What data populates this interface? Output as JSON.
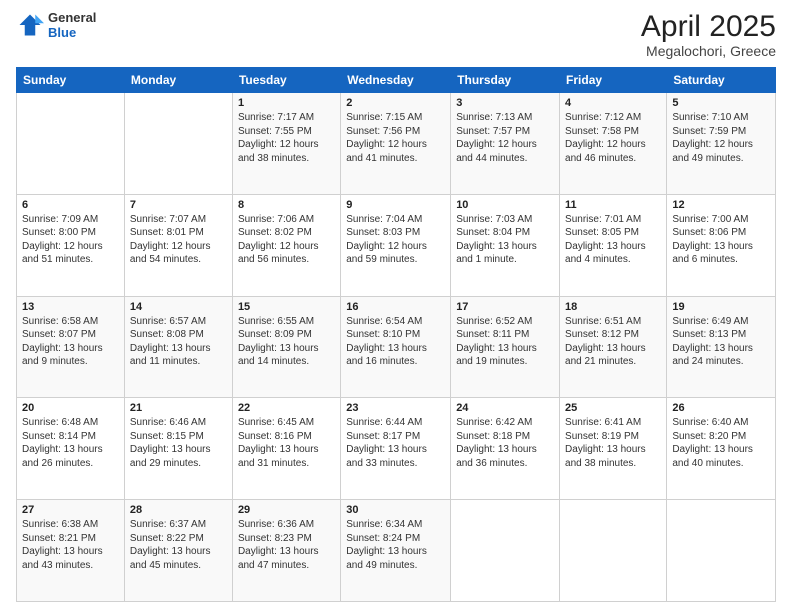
{
  "header": {
    "logo": {
      "general": "General",
      "blue": "Blue"
    },
    "title": "April 2025",
    "location": "Megalochori, Greece"
  },
  "weekdays": [
    "Sunday",
    "Monday",
    "Tuesday",
    "Wednesday",
    "Thursday",
    "Friday",
    "Saturday"
  ],
  "weeks": [
    [
      {
        "day": "",
        "info": ""
      },
      {
        "day": "",
        "info": ""
      },
      {
        "day": "1",
        "info": "Sunrise: 7:17 AM\nSunset: 7:55 PM\nDaylight: 12 hours and 38 minutes."
      },
      {
        "day": "2",
        "info": "Sunrise: 7:15 AM\nSunset: 7:56 PM\nDaylight: 12 hours and 41 minutes."
      },
      {
        "day": "3",
        "info": "Sunrise: 7:13 AM\nSunset: 7:57 PM\nDaylight: 12 hours and 44 minutes."
      },
      {
        "day": "4",
        "info": "Sunrise: 7:12 AM\nSunset: 7:58 PM\nDaylight: 12 hours and 46 minutes."
      },
      {
        "day": "5",
        "info": "Sunrise: 7:10 AM\nSunset: 7:59 PM\nDaylight: 12 hours and 49 minutes."
      }
    ],
    [
      {
        "day": "6",
        "info": "Sunrise: 7:09 AM\nSunset: 8:00 PM\nDaylight: 12 hours and 51 minutes."
      },
      {
        "day": "7",
        "info": "Sunrise: 7:07 AM\nSunset: 8:01 PM\nDaylight: 12 hours and 54 minutes."
      },
      {
        "day": "8",
        "info": "Sunrise: 7:06 AM\nSunset: 8:02 PM\nDaylight: 12 hours and 56 minutes."
      },
      {
        "day": "9",
        "info": "Sunrise: 7:04 AM\nSunset: 8:03 PM\nDaylight: 12 hours and 59 minutes."
      },
      {
        "day": "10",
        "info": "Sunrise: 7:03 AM\nSunset: 8:04 PM\nDaylight: 13 hours and 1 minute."
      },
      {
        "day": "11",
        "info": "Sunrise: 7:01 AM\nSunset: 8:05 PM\nDaylight: 13 hours and 4 minutes."
      },
      {
        "day": "12",
        "info": "Sunrise: 7:00 AM\nSunset: 8:06 PM\nDaylight: 13 hours and 6 minutes."
      }
    ],
    [
      {
        "day": "13",
        "info": "Sunrise: 6:58 AM\nSunset: 8:07 PM\nDaylight: 13 hours and 9 minutes."
      },
      {
        "day": "14",
        "info": "Sunrise: 6:57 AM\nSunset: 8:08 PM\nDaylight: 13 hours and 11 minutes."
      },
      {
        "day": "15",
        "info": "Sunrise: 6:55 AM\nSunset: 8:09 PM\nDaylight: 13 hours and 14 minutes."
      },
      {
        "day": "16",
        "info": "Sunrise: 6:54 AM\nSunset: 8:10 PM\nDaylight: 13 hours and 16 minutes."
      },
      {
        "day": "17",
        "info": "Sunrise: 6:52 AM\nSunset: 8:11 PM\nDaylight: 13 hours and 19 minutes."
      },
      {
        "day": "18",
        "info": "Sunrise: 6:51 AM\nSunset: 8:12 PM\nDaylight: 13 hours and 21 minutes."
      },
      {
        "day": "19",
        "info": "Sunrise: 6:49 AM\nSunset: 8:13 PM\nDaylight: 13 hours and 24 minutes."
      }
    ],
    [
      {
        "day": "20",
        "info": "Sunrise: 6:48 AM\nSunset: 8:14 PM\nDaylight: 13 hours and 26 minutes."
      },
      {
        "day": "21",
        "info": "Sunrise: 6:46 AM\nSunset: 8:15 PM\nDaylight: 13 hours and 29 minutes."
      },
      {
        "day": "22",
        "info": "Sunrise: 6:45 AM\nSunset: 8:16 PM\nDaylight: 13 hours and 31 minutes."
      },
      {
        "day": "23",
        "info": "Sunrise: 6:44 AM\nSunset: 8:17 PM\nDaylight: 13 hours and 33 minutes."
      },
      {
        "day": "24",
        "info": "Sunrise: 6:42 AM\nSunset: 8:18 PM\nDaylight: 13 hours and 36 minutes."
      },
      {
        "day": "25",
        "info": "Sunrise: 6:41 AM\nSunset: 8:19 PM\nDaylight: 13 hours and 38 minutes."
      },
      {
        "day": "26",
        "info": "Sunrise: 6:40 AM\nSunset: 8:20 PM\nDaylight: 13 hours and 40 minutes."
      }
    ],
    [
      {
        "day": "27",
        "info": "Sunrise: 6:38 AM\nSunset: 8:21 PM\nDaylight: 13 hours and 43 minutes."
      },
      {
        "day": "28",
        "info": "Sunrise: 6:37 AM\nSunset: 8:22 PM\nDaylight: 13 hours and 45 minutes."
      },
      {
        "day": "29",
        "info": "Sunrise: 6:36 AM\nSunset: 8:23 PM\nDaylight: 13 hours and 47 minutes."
      },
      {
        "day": "30",
        "info": "Sunrise: 6:34 AM\nSunset: 8:24 PM\nDaylight: 13 hours and 49 minutes."
      },
      {
        "day": "",
        "info": ""
      },
      {
        "day": "",
        "info": ""
      },
      {
        "day": "",
        "info": ""
      }
    ]
  ]
}
